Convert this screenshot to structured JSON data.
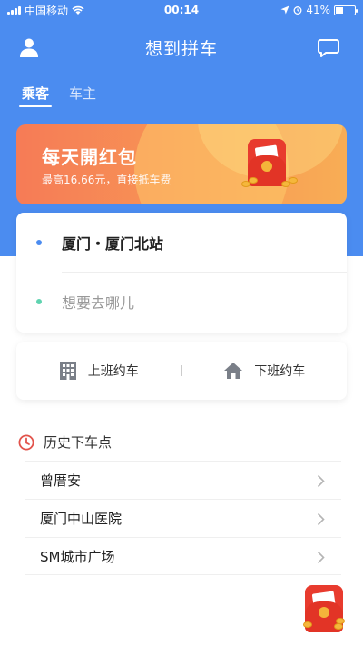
{
  "status_bar": {
    "carrier": "中国移动",
    "time": "00:14",
    "battery_text": "41%",
    "battery_level": 0.41
  },
  "header": {
    "title": "想到拼车"
  },
  "tabs": [
    {
      "label": "乘客",
      "active": true
    },
    {
      "label": "车主",
      "active": false
    }
  ],
  "banner": {
    "title": "每天開红包",
    "subtitle": "最高16.66元，直接抵车费"
  },
  "location": {
    "from": "厦门・厦门北站",
    "to_placeholder": "想要去哪儿",
    "from_dot_color": "#4b8cf0",
    "to_dot_color": "#5fd3b0"
  },
  "commute": {
    "to_work_label": "上班约车",
    "to_home_label": "下班约车"
  },
  "history": {
    "title": "历史下车点",
    "items": [
      {
        "name": "曾厝安"
      },
      {
        "name": "厦门中山医院"
      },
      {
        "name": "SM城市广场"
      }
    ]
  },
  "colors": {
    "brand_blue": "#4b8cf0",
    "history_icon": "#e2534b"
  }
}
